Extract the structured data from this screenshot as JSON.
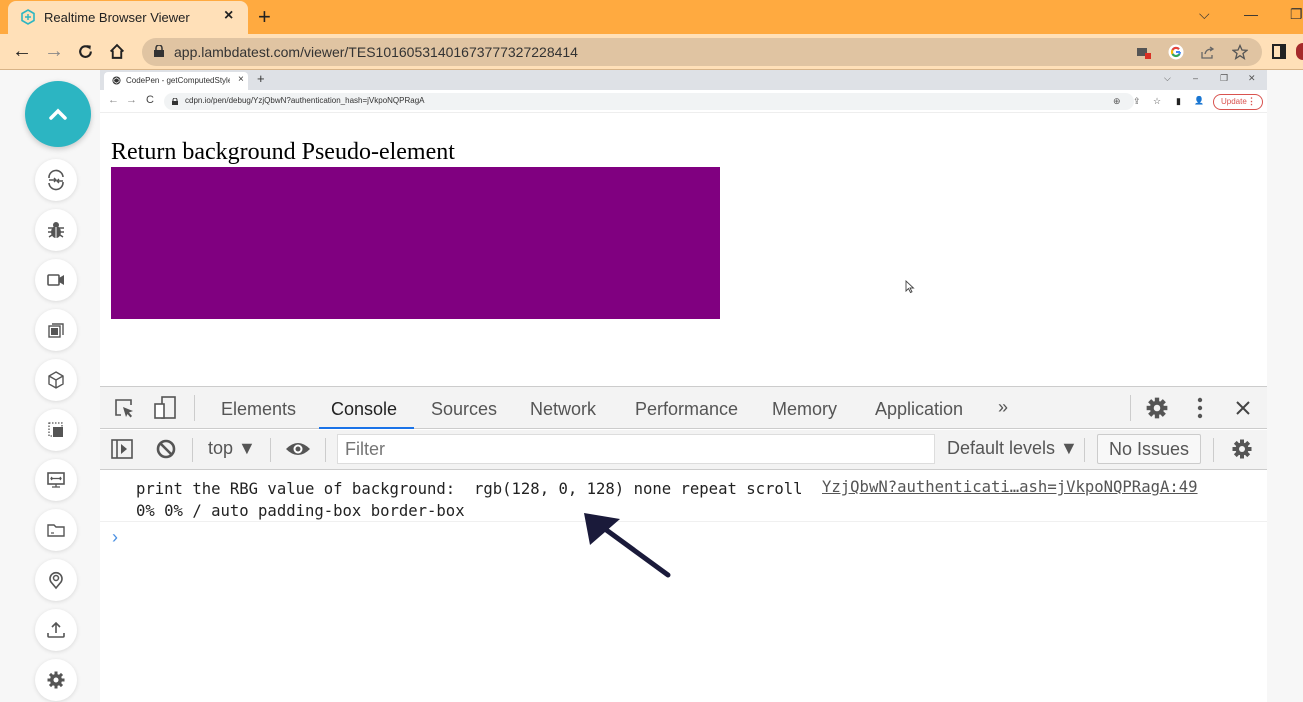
{
  "outer_browser": {
    "tab_title": "Realtime Browser Viewer",
    "tab_close": "×",
    "new_tab": "+",
    "url": "app.lambdatest.com/viewer/TES10160531401673777327228414",
    "window_controls": {
      "tab_search": "⌵",
      "minimize": "—",
      "restore": "❐"
    },
    "brand_color": "#2cb5c2",
    "chrome_color": "#ffaa40"
  },
  "sidebar": {
    "items": [
      {
        "name": "collapse",
        "icon": "chevron-up-icon"
      },
      {
        "name": "switch-browser",
        "icon": "switch-icon"
      },
      {
        "name": "bug",
        "icon": "bug-icon"
      },
      {
        "name": "record",
        "icon": "video-camera-icon"
      },
      {
        "name": "screenshot",
        "icon": "gallery-icon"
      },
      {
        "name": "3d-box",
        "icon": "cube-icon"
      },
      {
        "name": "resize",
        "icon": "resize-icon"
      },
      {
        "name": "resolution",
        "icon": "monitor-icon"
      },
      {
        "name": "files",
        "icon": "folder-icon"
      },
      {
        "name": "geolocation",
        "icon": "location-pin-icon"
      },
      {
        "name": "upload",
        "icon": "upload-icon"
      },
      {
        "name": "settings",
        "icon": "gear-icon"
      }
    ]
  },
  "inner_browser": {
    "tab_title": "CodePen - getComputedStyles P",
    "tab_close": "×",
    "new_tab": "+",
    "url": "cdpn.io/pen/debug/YzjQbwN?authentication_hash=jVkpoNQPRagA",
    "update_label": "Update",
    "update_dots": "⋮",
    "window_controls": {
      "tab_search": "⌵",
      "minimize": "–",
      "restore": "❐",
      "close": "✕"
    },
    "nav": {
      "back": "←",
      "forward": "→",
      "reload": "C"
    },
    "tools": {
      "zoom": "⊕",
      "share": "⇪",
      "bookmark": "☆",
      "sidepanel": "▮",
      "profile": "👤"
    }
  },
  "page": {
    "heading": "Return background Pseudo-element",
    "box_color": "#800080"
  },
  "devtools": {
    "tabs": [
      {
        "label": "Elements",
        "active": false
      },
      {
        "label": "Console",
        "active": true
      },
      {
        "label": "Sources",
        "active": false
      },
      {
        "label": "Network",
        "active": false
      },
      {
        "label": "Performance",
        "active": false
      },
      {
        "label": "Memory",
        "active": false
      },
      {
        "label": "Application",
        "active": false
      }
    ],
    "more_tabs": "»",
    "context": "top ▼",
    "filter_placeholder": "Filter",
    "levels": "Default levels ▼",
    "issues": "No Issues",
    "console": {
      "message": "print the RBG value of background:  rgb(128, 0, 128) none repeat scroll 0% 0% / auto padding-box border-box",
      "source": "YzjQbwN?authenticati…ash=jVkpoNQPRagA:49",
      "prompt": "›"
    }
  }
}
